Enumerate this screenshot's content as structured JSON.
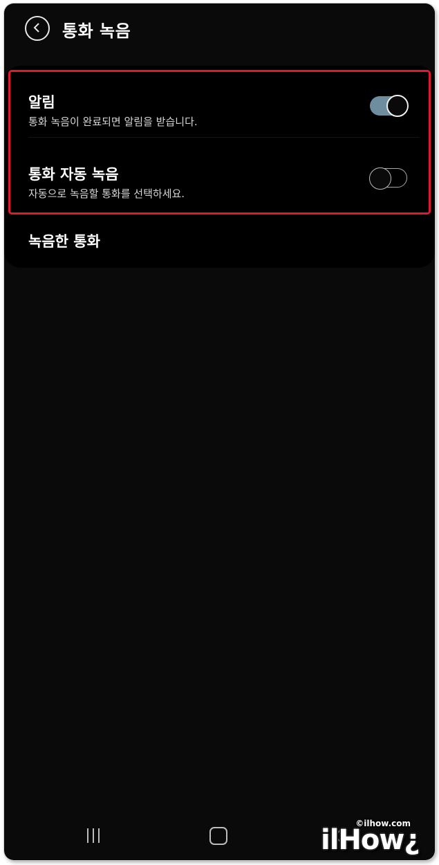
{
  "header": {
    "title": "통화 녹음",
    "back_icon": "chevron-left-icon"
  },
  "settings": {
    "items": [
      {
        "title": "알림",
        "subtitle": "통화 녹음이 완료되면 알림을 받습니다.",
        "toggle": "on"
      },
      {
        "title": "통화 자동 녹음",
        "subtitle": "자동으로 녹음할 통화를 선택하세요.",
        "toggle": "off"
      },
      {
        "title": "녹음한 통화"
      }
    ]
  },
  "colors": {
    "toggle_on": "#6e8ea0",
    "highlight": "#e0192e",
    "background": "#0a0a0a"
  },
  "navbar": {
    "recent_icon": "recent-apps-icon",
    "home_icon": "home-icon",
    "back_icon": "back-icon"
  },
  "watermark": {
    "url": "©ilhow.com",
    "logo": "ilHow¿"
  }
}
